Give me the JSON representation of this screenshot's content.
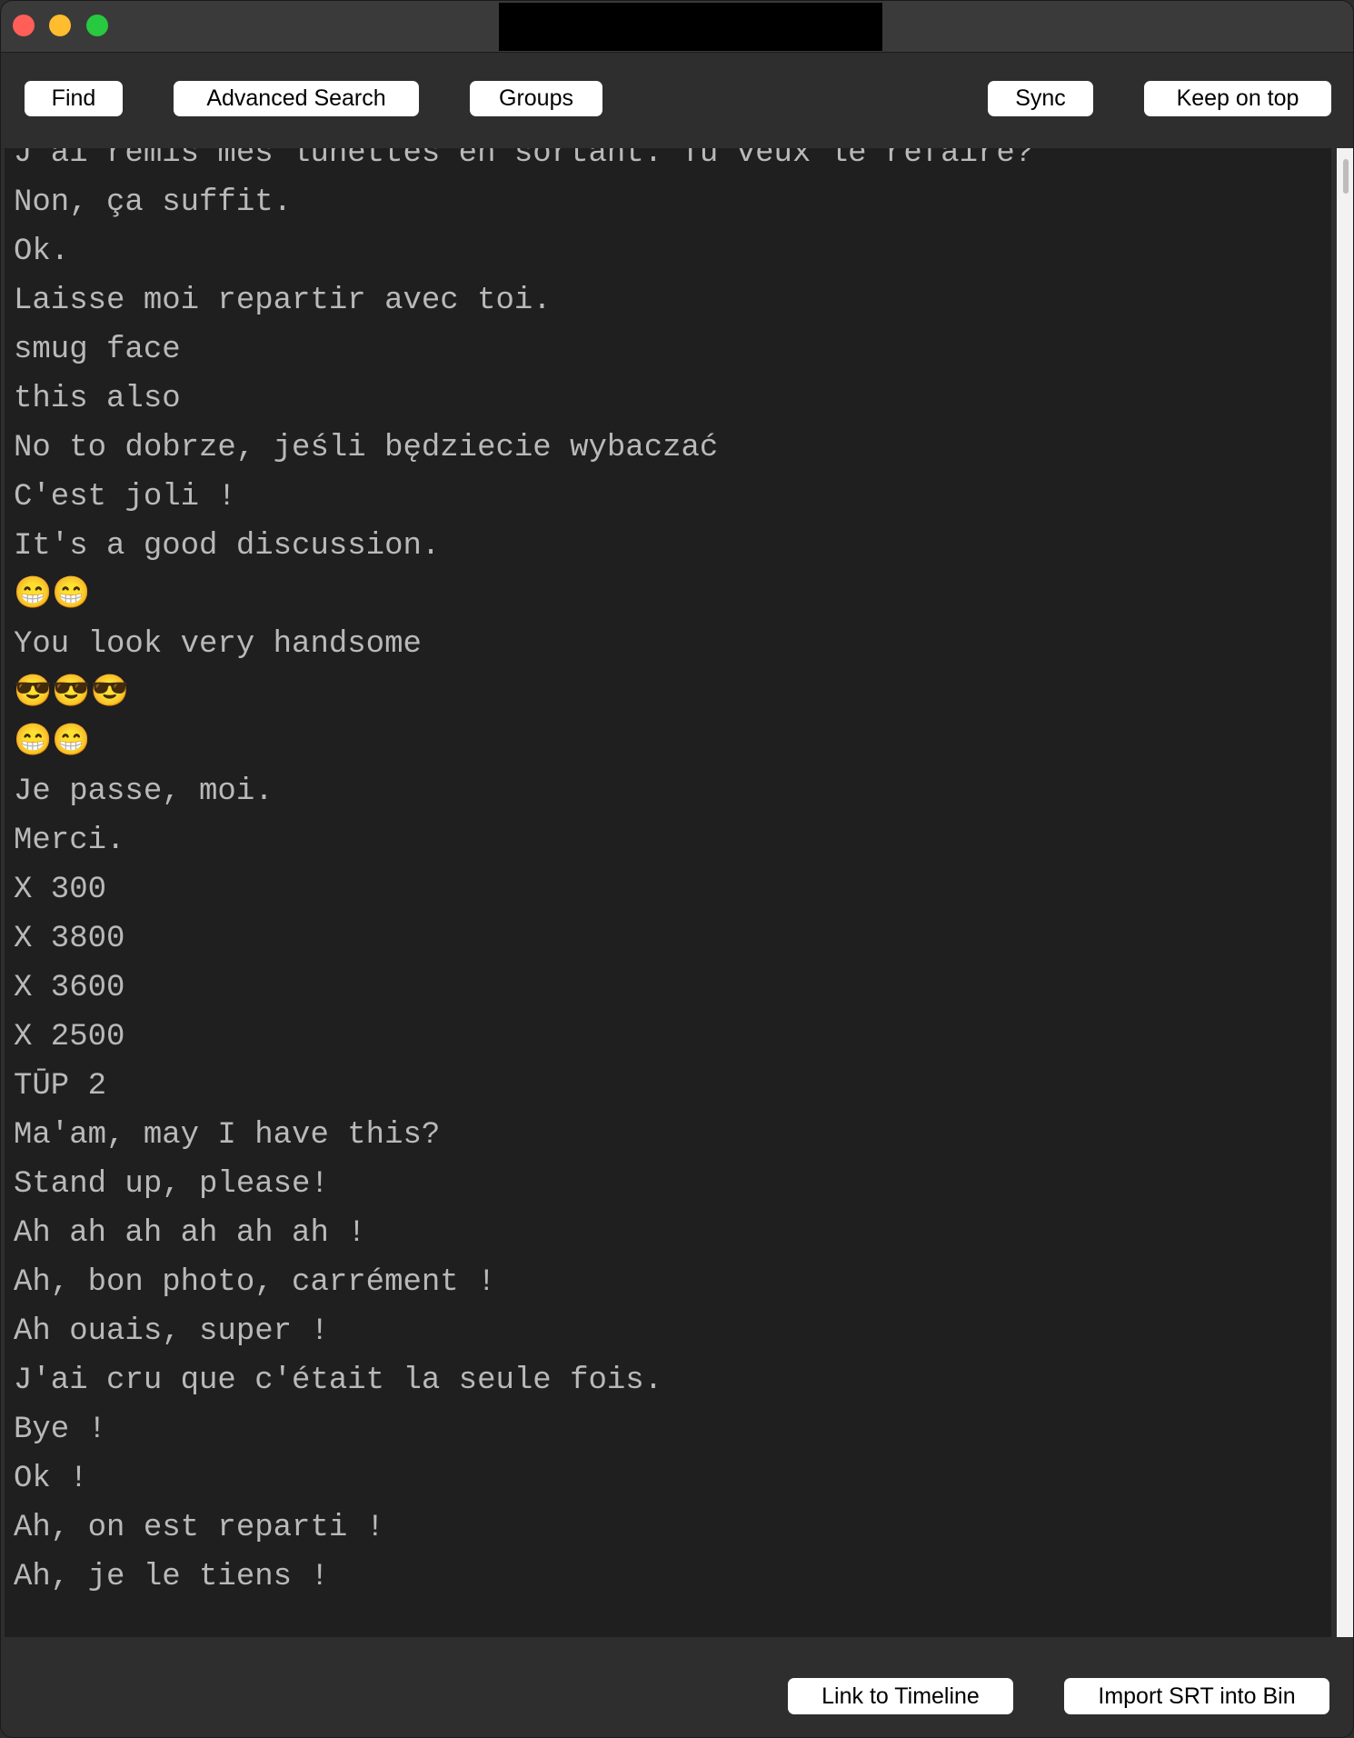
{
  "window": {
    "title": ""
  },
  "toolbar": {
    "find_label": "Find",
    "advanced_search_label": "Advanced Search",
    "groups_label": "Groups",
    "sync_label": "Sync",
    "keep_on_top_label": "Keep on top"
  },
  "subtitles": [
    "J'ai remis mes lunettes en sortant. Tu veux le refaire?",
    "Non, ça suffit.",
    "Ok.",
    "Laisse moi repartir avec toi.",
    "smug face",
    "this also",
    "No to dobrze, jeśli będziecie wybaczać",
    "C'est joli !",
    "It's a good discussion.",
    "😁😁",
    "You look very handsome",
    "😎😎😎",
    "😁😁",
    "Je passe, moi.",
    "Merci.",
    "X 300",
    "X 3800",
    "X 3600",
    "X 2500",
    "TŪP 2",
    "Ma'am, may I have this?",
    "Stand up, please!",
    "Ah ah ah ah ah ah !",
    "Ah, bon photo, carrément !",
    "Ah ouais, super !",
    "J'ai cru que c'était la seule fois.",
    "Bye !",
    "Ok !",
    "Ah, on est reparti !",
    "Ah, je le tiens !"
  ],
  "bottom": {
    "link_to_timeline_label": "Link to Timeline",
    "import_srt_label": "Import SRT into Bin"
  },
  "colors": {
    "text": "#b9b9b9",
    "panel_bg": "#1f1f1f",
    "window_bg": "#2e2e2e"
  }
}
